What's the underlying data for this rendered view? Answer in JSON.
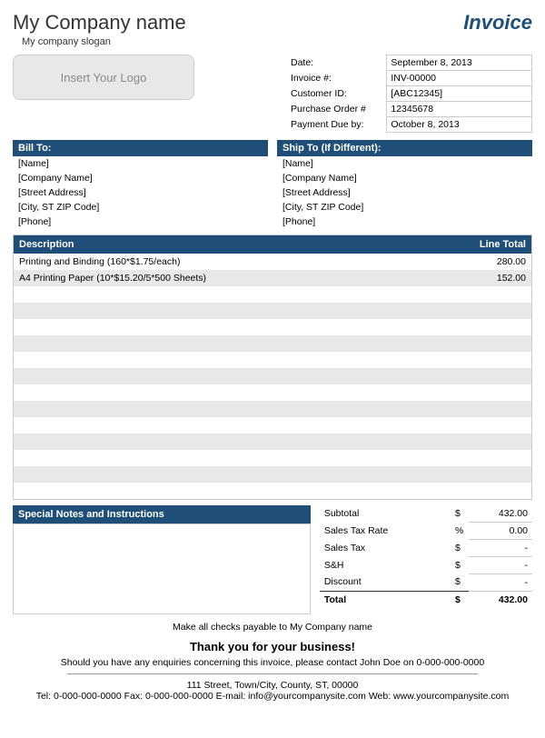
{
  "header": {
    "company_name": "My Company name",
    "slogan": "My company slogan",
    "title": "Invoice",
    "logo_placeholder": "Insert Your Logo"
  },
  "meta": {
    "date_label": "Date:",
    "date_value": "September 8, 2013",
    "invnum_label": "Invoice #:",
    "invnum_value": "INV-00000",
    "custid_label": "Customer ID:",
    "custid_value": "[ABC12345]",
    "po_label": "Purchase Order #",
    "po_value": "12345678",
    "due_label": "Payment Due by:",
    "due_value": "October 8, 2013"
  },
  "billto": {
    "header": "Bill To:",
    "name": "[Name]",
    "company": "[Company Name]",
    "street": "[Street Address]",
    "csz": "[City, ST  ZIP Code]",
    "phone": "[Phone]"
  },
  "shipto": {
    "header": "Ship To (If Different):",
    "name": "[Name]",
    "company": "[Company Name]",
    "street": "[Street Address]",
    "csz": "[City, ST  ZIP Code]",
    "phone": "[Phone]"
  },
  "items": {
    "desc_header": "Description",
    "total_header": "Line Total",
    "rows": [
      {
        "desc": "Printing and Binding (160*$1.75/each)",
        "total": "280.00"
      },
      {
        "desc": "A4 Printing Paper (10*$15.20/5*500 Sheets)",
        "total": "152.00"
      }
    ]
  },
  "notes_header": "Special Notes and Instructions",
  "totals": {
    "subtotal_label": "Subtotal",
    "subtotal_sym": "$",
    "subtotal_val": "432.00",
    "taxrate_label": "Sales Tax Rate",
    "taxrate_sym": "%",
    "taxrate_val": "0.00",
    "tax_label": "Sales Tax",
    "tax_sym": "$",
    "tax_val": "-",
    "sh_label": "S&H",
    "sh_sym": "$",
    "sh_val": "-",
    "disc_label": "Discount",
    "disc_sym": "$",
    "disc_val": "-",
    "total_label": "Total",
    "total_sym": "$",
    "total_val": "432.00"
  },
  "footer": {
    "payable": "Make all checks payable to My Company name",
    "thanks": "Thank you for your business!",
    "contact": "Should you have any enquiries concerning this invoice, please contact John Doe on 0-000-000-0000",
    "address": "111 Street, Town/City, County, ST, 00000",
    "comm": "Tel: 0-000-000-0000 Fax: 0-000-000-0000 E-mail: info@yourcompanysite.com Web: www.yourcompanysite.com"
  }
}
